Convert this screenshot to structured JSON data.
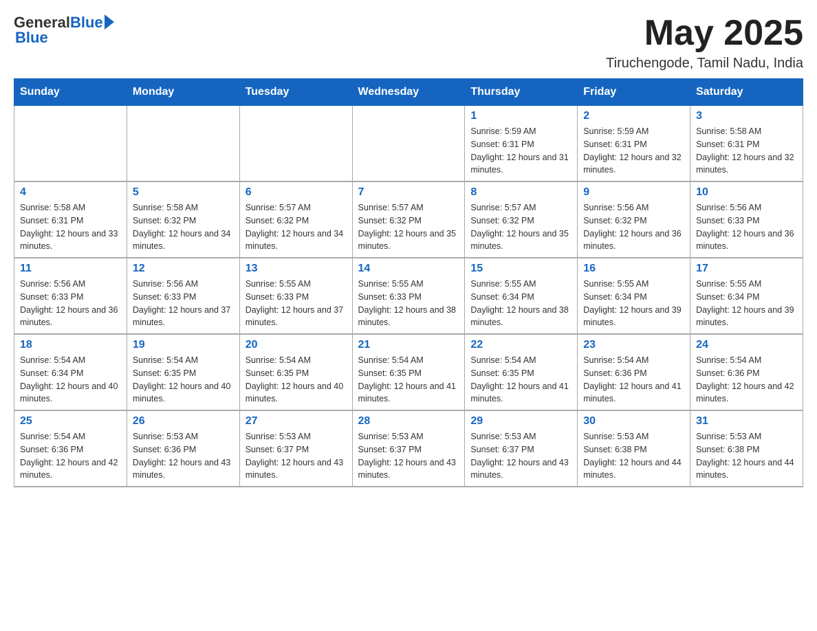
{
  "header": {
    "logo_general": "General",
    "logo_blue": "Blue",
    "month_title": "May 2025",
    "location": "Tiruchengode, Tamil Nadu, India"
  },
  "days_of_week": [
    "Sunday",
    "Monday",
    "Tuesday",
    "Wednesday",
    "Thursday",
    "Friday",
    "Saturday"
  ],
  "weeks": [
    [
      {
        "day": "",
        "sunrise": "",
        "sunset": "",
        "daylight": ""
      },
      {
        "day": "",
        "sunrise": "",
        "sunset": "",
        "daylight": ""
      },
      {
        "day": "",
        "sunrise": "",
        "sunset": "",
        "daylight": ""
      },
      {
        "day": "",
        "sunrise": "",
        "sunset": "",
        "daylight": ""
      },
      {
        "day": "1",
        "sunrise": "Sunrise: 5:59 AM",
        "sunset": "Sunset: 6:31 PM",
        "daylight": "Daylight: 12 hours and 31 minutes."
      },
      {
        "day": "2",
        "sunrise": "Sunrise: 5:59 AM",
        "sunset": "Sunset: 6:31 PM",
        "daylight": "Daylight: 12 hours and 32 minutes."
      },
      {
        "day": "3",
        "sunrise": "Sunrise: 5:58 AM",
        "sunset": "Sunset: 6:31 PM",
        "daylight": "Daylight: 12 hours and 32 minutes."
      }
    ],
    [
      {
        "day": "4",
        "sunrise": "Sunrise: 5:58 AM",
        "sunset": "Sunset: 6:31 PM",
        "daylight": "Daylight: 12 hours and 33 minutes."
      },
      {
        "day": "5",
        "sunrise": "Sunrise: 5:58 AM",
        "sunset": "Sunset: 6:32 PM",
        "daylight": "Daylight: 12 hours and 34 minutes."
      },
      {
        "day": "6",
        "sunrise": "Sunrise: 5:57 AM",
        "sunset": "Sunset: 6:32 PM",
        "daylight": "Daylight: 12 hours and 34 minutes."
      },
      {
        "day": "7",
        "sunrise": "Sunrise: 5:57 AM",
        "sunset": "Sunset: 6:32 PM",
        "daylight": "Daylight: 12 hours and 35 minutes."
      },
      {
        "day": "8",
        "sunrise": "Sunrise: 5:57 AM",
        "sunset": "Sunset: 6:32 PM",
        "daylight": "Daylight: 12 hours and 35 minutes."
      },
      {
        "day": "9",
        "sunrise": "Sunrise: 5:56 AM",
        "sunset": "Sunset: 6:32 PM",
        "daylight": "Daylight: 12 hours and 36 minutes."
      },
      {
        "day": "10",
        "sunrise": "Sunrise: 5:56 AM",
        "sunset": "Sunset: 6:33 PM",
        "daylight": "Daylight: 12 hours and 36 minutes."
      }
    ],
    [
      {
        "day": "11",
        "sunrise": "Sunrise: 5:56 AM",
        "sunset": "Sunset: 6:33 PM",
        "daylight": "Daylight: 12 hours and 36 minutes."
      },
      {
        "day": "12",
        "sunrise": "Sunrise: 5:56 AM",
        "sunset": "Sunset: 6:33 PM",
        "daylight": "Daylight: 12 hours and 37 minutes."
      },
      {
        "day": "13",
        "sunrise": "Sunrise: 5:55 AM",
        "sunset": "Sunset: 6:33 PM",
        "daylight": "Daylight: 12 hours and 37 minutes."
      },
      {
        "day": "14",
        "sunrise": "Sunrise: 5:55 AM",
        "sunset": "Sunset: 6:33 PM",
        "daylight": "Daylight: 12 hours and 38 minutes."
      },
      {
        "day": "15",
        "sunrise": "Sunrise: 5:55 AM",
        "sunset": "Sunset: 6:34 PM",
        "daylight": "Daylight: 12 hours and 38 minutes."
      },
      {
        "day": "16",
        "sunrise": "Sunrise: 5:55 AM",
        "sunset": "Sunset: 6:34 PM",
        "daylight": "Daylight: 12 hours and 39 minutes."
      },
      {
        "day": "17",
        "sunrise": "Sunrise: 5:55 AM",
        "sunset": "Sunset: 6:34 PM",
        "daylight": "Daylight: 12 hours and 39 minutes."
      }
    ],
    [
      {
        "day": "18",
        "sunrise": "Sunrise: 5:54 AM",
        "sunset": "Sunset: 6:34 PM",
        "daylight": "Daylight: 12 hours and 40 minutes."
      },
      {
        "day": "19",
        "sunrise": "Sunrise: 5:54 AM",
        "sunset": "Sunset: 6:35 PM",
        "daylight": "Daylight: 12 hours and 40 minutes."
      },
      {
        "day": "20",
        "sunrise": "Sunrise: 5:54 AM",
        "sunset": "Sunset: 6:35 PM",
        "daylight": "Daylight: 12 hours and 40 minutes."
      },
      {
        "day": "21",
        "sunrise": "Sunrise: 5:54 AM",
        "sunset": "Sunset: 6:35 PM",
        "daylight": "Daylight: 12 hours and 41 minutes."
      },
      {
        "day": "22",
        "sunrise": "Sunrise: 5:54 AM",
        "sunset": "Sunset: 6:35 PM",
        "daylight": "Daylight: 12 hours and 41 minutes."
      },
      {
        "day": "23",
        "sunrise": "Sunrise: 5:54 AM",
        "sunset": "Sunset: 6:36 PM",
        "daylight": "Daylight: 12 hours and 41 minutes."
      },
      {
        "day": "24",
        "sunrise": "Sunrise: 5:54 AM",
        "sunset": "Sunset: 6:36 PM",
        "daylight": "Daylight: 12 hours and 42 minutes."
      }
    ],
    [
      {
        "day": "25",
        "sunrise": "Sunrise: 5:54 AM",
        "sunset": "Sunset: 6:36 PM",
        "daylight": "Daylight: 12 hours and 42 minutes."
      },
      {
        "day": "26",
        "sunrise": "Sunrise: 5:53 AM",
        "sunset": "Sunset: 6:36 PM",
        "daylight": "Daylight: 12 hours and 43 minutes."
      },
      {
        "day": "27",
        "sunrise": "Sunrise: 5:53 AM",
        "sunset": "Sunset: 6:37 PM",
        "daylight": "Daylight: 12 hours and 43 minutes."
      },
      {
        "day": "28",
        "sunrise": "Sunrise: 5:53 AM",
        "sunset": "Sunset: 6:37 PM",
        "daylight": "Daylight: 12 hours and 43 minutes."
      },
      {
        "day": "29",
        "sunrise": "Sunrise: 5:53 AM",
        "sunset": "Sunset: 6:37 PM",
        "daylight": "Daylight: 12 hours and 43 minutes."
      },
      {
        "day": "30",
        "sunrise": "Sunrise: 5:53 AM",
        "sunset": "Sunset: 6:38 PM",
        "daylight": "Daylight: 12 hours and 44 minutes."
      },
      {
        "day": "31",
        "sunrise": "Sunrise: 5:53 AM",
        "sunset": "Sunset: 6:38 PM",
        "daylight": "Daylight: 12 hours and 44 minutes."
      }
    ]
  ]
}
